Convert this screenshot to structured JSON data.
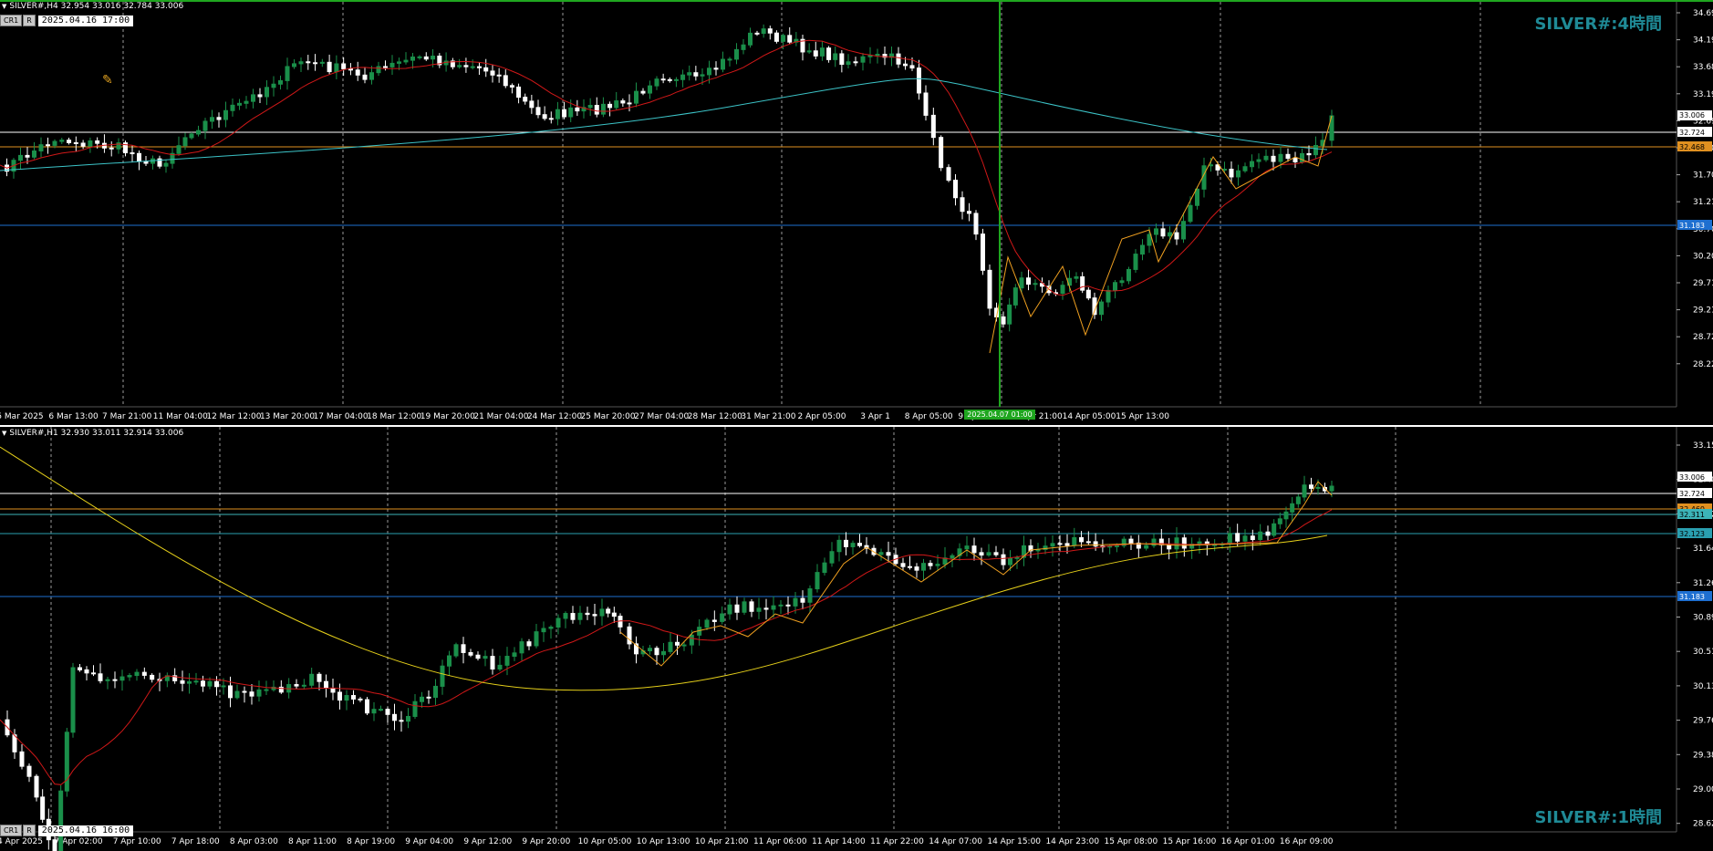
{
  "top": {
    "header": "SILVER#,H4  32.954 33.016 32.784 33.006",
    "btn_cr": "CR1",
    "btn_r": "R",
    "datetime": "2025.04.16 17:00",
    "watermark": "SILVER#:4時間",
    "price_labels": [
      "34.690",
      "34.195",
      "33.685",
      "33.190",
      "32.695",
      "32.200",
      "31.705",
      "31.210",
      "30.700",
      "30.205",
      "29.710",
      "29.215",
      "28.720",
      "28.225"
    ],
    "line_labels": {
      "white": "33.006",
      "white2": "32.724",
      "orange": "32.468",
      "blue": "31.183"
    },
    "time_labels": [
      "5 Mar 2025",
      "6 Mar 13:00",
      "7 Mar 21:00",
      "11 Mar 04:00",
      "12 Mar 12:00",
      "13 Mar 20:00",
      "17 Mar 04:00",
      "18 Mar 12:00",
      "19 Mar 20:00",
      "21 Mar 04:00",
      "24 Mar 12:00",
      "25 Mar 20:00",
      "27 Mar 04:00",
      "28 Mar 12:00",
      "31 Mar 21:00",
      "2 Apr 05:00",
      "3 Apr 1",
      "8 Apr 05:00",
      "9 Apr 13:00",
      "10 Apr 21:00",
      "14 Apr 05:00",
      "15 Apr 13:00"
    ],
    "cursor_time": "2025.04.07 01:00"
  },
  "bottom": {
    "header": "SILVER#,H1  32.930 33.011 32.914 33.006",
    "btn_cr": "CR1",
    "btn_r": "R",
    "datetime": "2025.04.16 16:00",
    "watermark": "SILVER#:1時間",
    "price_labels": [
      "33.150",
      "32.400",
      "32.020",
      "31.640",
      "31.260",
      "30.890",
      "30.510",
      "30.130",
      "29.760",
      "29.380",
      "29.000",
      "28.620"
    ],
    "line_labels": {
      "white": "33.006",
      "white2": "32.724",
      "orange": "32.460",
      "teal": "32.311",
      "teal2": "32.123",
      "blue": "31.183"
    },
    "time_labels": [
      "4 Apr 2025",
      "7 Apr 02:00",
      "7 Apr 10:00",
      "7 Apr 18:00",
      "8 Apr 03:00",
      "8 Apr 11:00",
      "8 Apr 19:00",
      "9 Apr 04:00",
      "9 Apr 12:00",
      "9 Apr 20:00",
      "10 Apr 05:00",
      "10 Apr 13:00",
      "10 Apr 21:00",
      "11 Apr 06:00",
      "11 Apr 14:00",
      "11 Apr 22:00",
      "14 Apr 07:00",
      "14 Apr 15:00",
      "14 Apr 23:00",
      "15 Apr 08:00",
      "15 Apr 16:00",
      "16 Apr 01:00",
      "16 Apr 09:00"
    ]
  },
  "colors": {
    "bull": "#1a8f4a",
    "bear": "#ffffff",
    "ma_red": "#d01818",
    "ma_cyan": "#3cc4c8",
    "ma_yellow": "#e6d01a",
    "zigzag": "#f0a020",
    "hline_blue": "#1e6fd0",
    "hline_orange": "#e09020",
    "grid": "#9a9a9a",
    "axis_text": "#ffffff"
  },
  "icons": {
    "tool": "wrench-icon"
  }
}
